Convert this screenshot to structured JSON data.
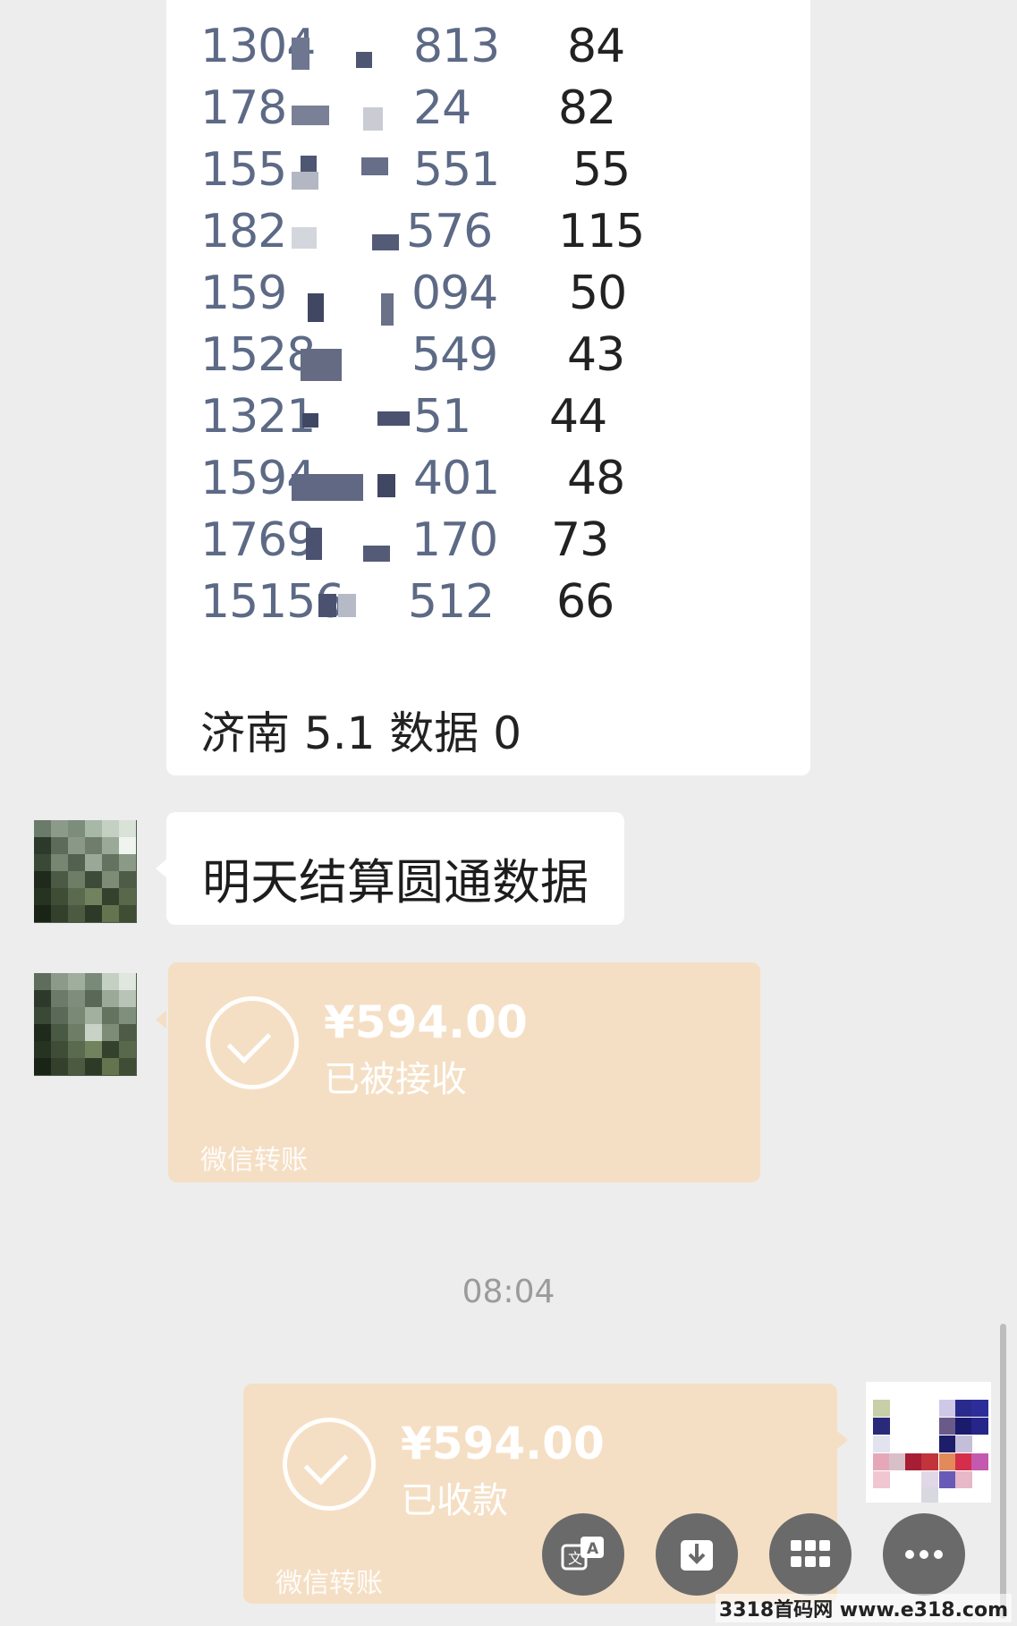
{
  "message1": {
    "rows": [
      {
        "number": "1304",
        "suffix": "813",
        "count": "84"
      },
      {
        "number": "178",
        "suffix": "24",
        "count": "82"
      },
      {
        "number": "155",
        "suffix": "551",
        "count": "55"
      },
      {
        "number": "182",
        "suffix": "576",
        "count": "115"
      },
      {
        "number": "159",
        "suffix": "094",
        "count": "50"
      },
      {
        "number": "1528",
        "suffix": "549",
        "count": "43"
      },
      {
        "number": "1321",
        "suffix": "51",
        "count": "44"
      },
      {
        "number": "1594",
        "suffix": "401",
        "count": "48"
      },
      {
        "number": "1769",
        "suffix": "170",
        "count": "73"
      },
      {
        "number": "15156",
        "suffix": "512",
        "count": "66"
      }
    ],
    "footer": "济南 5.1 数据 0"
  },
  "message2": {
    "text": "明天结算圆通数据"
  },
  "transfer_in": {
    "amount": "¥594.00",
    "status": "已被接收",
    "label": "微信转账"
  },
  "time": "08:04",
  "transfer_out": {
    "amount": "¥594.00",
    "status": "已收款",
    "label": "微信转账"
  },
  "watermark": "3318首码网 www.e318.com",
  "icons": [
    "translate-icon",
    "download-icon",
    "grid-icon",
    "more-icon"
  ],
  "colors": {
    "transfer_bg": "#f5dfc4",
    "bubble_bg": "#ffffff",
    "chat_bg": "#ededed"
  }
}
